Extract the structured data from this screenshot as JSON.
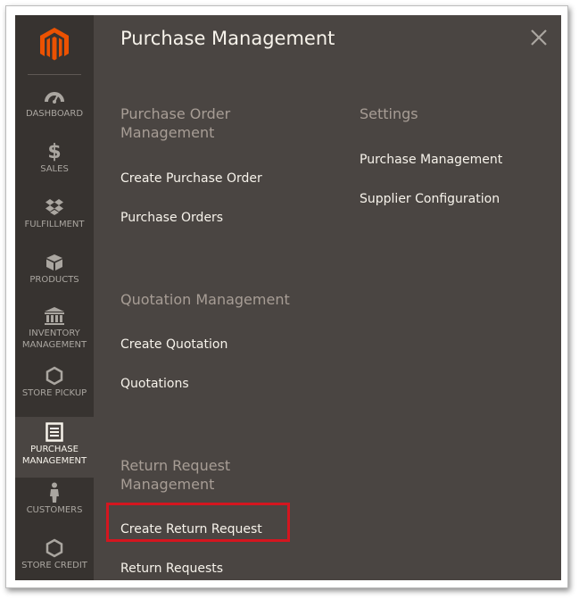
{
  "sidebar": {
    "items": [
      {
        "label": "DASHBOARD",
        "icon": "dashboard-icon"
      },
      {
        "label": "SALES",
        "icon": "dollar-icon"
      },
      {
        "label": "FULFILLMENT",
        "icon": "dropbox-icon"
      },
      {
        "label": "PRODUCTS",
        "icon": "cube-icon"
      },
      {
        "label": "INVENTORY MANAGEMENT",
        "icon": "bank-icon"
      },
      {
        "label": "STORE PICKUP",
        "icon": "hexagon-icon"
      },
      {
        "label": "PURCHASE MANAGEMENT",
        "icon": "document-icon",
        "active": true
      },
      {
        "label": "CUSTOMERS",
        "icon": "person-icon"
      },
      {
        "label": "STORE CREDIT",
        "icon": "hexagon-icon"
      }
    ]
  },
  "panel": {
    "title": "Purchase Management",
    "groups": [
      {
        "title": "Purchase Order Management",
        "links": [
          "Create Purchase Order",
          "Purchase Orders"
        ]
      },
      {
        "title": "Quotation Management",
        "links": [
          "Create Quotation",
          "Quotations"
        ]
      },
      {
        "title": "Return Request Management",
        "links": [
          "Create Return Request",
          "Return Requests"
        ]
      },
      {
        "title": "Settings",
        "links": [
          "Purchase Management",
          "Supplier Configuration"
        ]
      }
    ]
  },
  "colors": {
    "sidebar_bg": "#373330",
    "panel_bg": "#4a4542",
    "brand_orange": "#eb5202",
    "highlight": "#d4161f"
  }
}
